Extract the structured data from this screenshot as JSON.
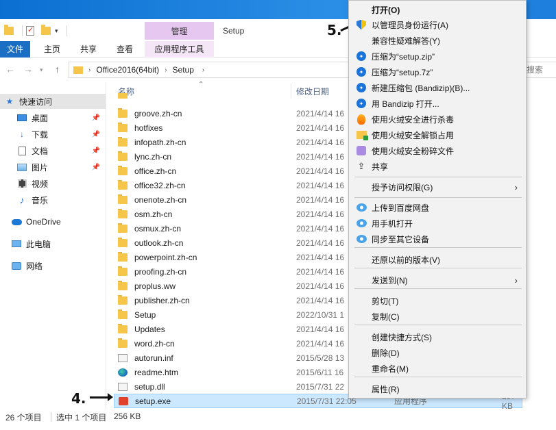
{
  "window": {
    "title": "Setup",
    "context_tab_header": "管理"
  },
  "ribbon": {
    "tabs": [
      "文件",
      "主页",
      "共享",
      "查看",
      "应用程序工具"
    ]
  },
  "address": {
    "crumbs": [
      "Office2016(64bit)",
      "Setup"
    ],
    "search_placeholder": "搜索"
  },
  "nav": {
    "quick_access": "快速访问",
    "items": [
      "桌面",
      "下载",
      "文档",
      "图片",
      "视频",
      "音乐"
    ],
    "onedrive": "OneDrive",
    "this_pc": "此电脑",
    "network": "网络"
  },
  "columns": {
    "name": "名称",
    "date": "修改日期"
  },
  "files": [
    {
      "name": "groove.zh-cn",
      "date": "2021/4/14 16",
      "type": "",
      "size": "",
      "icon": "folder"
    },
    {
      "name": "hotfixes",
      "date": "2021/4/14 16",
      "type": "",
      "size": "",
      "icon": "folder"
    },
    {
      "name": "infopath.zh-cn",
      "date": "2021/4/14 16",
      "type": "",
      "size": "",
      "icon": "folder"
    },
    {
      "name": "lync.zh-cn",
      "date": "2021/4/14 16",
      "type": "",
      "size": "",
      "icon": "folder"
    },
    {
      "name": "office.zh-cn",
      "date": "2021/4/14 16",
      "type": "",
      "size": "",
      "icon": "folder"
    },
    {
      "name": "office32.zh-cn",
      "date": "2021/4/14 16",
      "type": "",
      "size": "",
      "icon": "folder"
    },
    {
      "name": "onenote.zh-cn",
      "date": "2021/4/14 16",
      "type": "",
      "size": "",
      "icon": "folder"
    },
    {
      "name": "osm.zh-cn",
      "date": "2021/4/14 16",
      "type": "",
      "size": "",
      "icon": "folder"
    },
    {
      "name": "osmux.zh-cn",
      "date": "2021/4/14 16",
      "type": "",
      "size": "",
      "icon": "folder"
    },
    {
      "name": "outlook.zh-cn",
      "date": "2021/4/14 16",
      "type": "",
      "size": "",
      "icon": "folder"
    },
    {
      "name": "powerpoint.zh-cn",
      "date": "2021/4/14 16",
      "type": "",
      "size": "",
      "icon": "folder"
    },
    {
      "name": "proofing.zh-cn",
      "date": "2021/4/14 16",
      "type": "",
      "size": "",
      "icon": "folder"
    },
    {
      "name": "proplus.ww",
      "date": "2021/4/14 16",
      "type": "",
      "size": "",
      "icon": "folder"
    },
    {
      "name": "publisher.zh-cn",
      "date": "2021/4/14 16",
      "type": "",
      "size": "",
      "icon": "folder"
    },
    {
      "name": "Setup",
      "date": "2022/10/31 1",
      "type": "",
      "size": "",
      "icon": "folder"
    },
    {
      "name": "Updates",
      "date": "2021/4/14 16",
      "type": "",
      "size": "",
      "icon": "folder"
    },
    {
      "name": "word.zh-cn",
      "date": "2021/4/14 16",
      "type": "",
      "size": "",
      "icon": "folder"
    },
    {
      "name": "autorun.inf",
      "date": "2015/5/28 13",
      "type": "",
      "size": "",
      "icon": "file"
    },
    {
      "name": "readme.htm",
      "date": "2015/6/11 16",
      "type": "",
      "size": "",
      "icon": "edge"
    },
    {
      "name": "setup.dll",
      "date": "2015/7/31 22",
      "type": "",
      "size": "",
      "icon": "file"
    },
    {
      "name": "setup.exe",
      "date": "2015/7/31 22:05",
      "type": "应用程序",
      "size": "257 KB",
      "icon": "office"
    }
  ],
  "status": {
    "count": "26 个项目",
    "selected": "选中 1 个项目",
    "size": "256 KB"
  },
  "annotations": {
    "step4": "4.",
    "step5": "5."
  },
  "context_menu": {
    "items": [
      {
        "label": "打开(O)",
        "bold": true,
        "icon": ""
      },
      {
        "label": "以管理员身份运行(A)",
        "icon": "uac-shield-icon"
      },
      {
        "label": "兼容性疑难解答(Y)",
        "icon": ""
      },
      {
        "label": "压缩为“setup.zip”",
        "icon": "bandizip-icon"
      },
      {
        "label": "压缩为“setup.7z”",
        "icon": "bandizip-icon"
      },
      {
        "label": "新建压缩包 (Bandizip)(B)...",
        "icon": "bandizip-icon"
      },
      {
        "label": "用 Bandizip 打开...",
        "icon": "bandizip-icon"
      },
      {
        "label": "使用火绒安全进行杀毒",
        "icon": "huorong-fire-icon"
      },
      {
        "label": "使用火绒安全解锁占用",
        "icon": "huorong-unlock-icon"
      },
      {
        "label": "使用火绒安全粉碎文件",
        "icon": "huorong-shred-icon"
      },
      {
        "label": "共享",
        "icon": "share-icon"
      },
      {
        "label": "授予访问权限(G)",
        "icon": "",
        "submenu": true
      },
      {
        "label": "上传到百度网盘",
        "icon": "baidu-cloud-icon"
      },
      {
        "label": "用手机打开",
        "icon": "baidu-cloud-icon"
      },
      {
        "label": "同步至其它设备",
        "icon": "baidu-cloud-icon"
      },
      {
        "label": "还原以前的版本(V)",
        "icon": ""
      },
      {
        "label": "发送到(N)",
        "icon": "",
        "submenu": true
      },
      {
        "label": "剪切(T)",
        "icon": ""
      },
      {
        "label": "复制(C)",
        "icon": ""
      },
      {
        "label": "创建快捷方式(S)",
        "icon": ""
      },
      {
        "label": "删除(D)",
        "icon": ""
      },
      {
        "label": "重命名(M)",
        "icon": ""
      },
      {
        "label": "属性(R)",
        "icon": ""
      }
    ]
  }
}
